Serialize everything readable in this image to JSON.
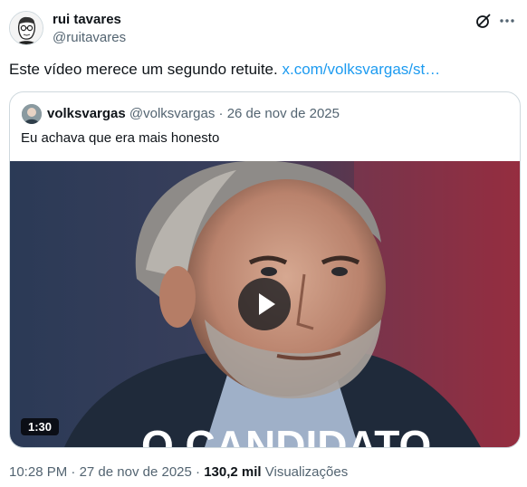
{
  "author": {
    "name": "rui tavares",
    "handle": "@ruitavares",
    "avatar_icon": "avatar-illustration-icon"
  },
  "actions": {
    "grok_icon": "grok-icon",
    "more_icon": "more-icon"
  },
  "tweet": {
    "text": "Este vídeo merece um segundo retuite.",
    "link": "x.com/volksvargas/st…"
  },
  "quoted": {
    "name": "volksvargas",
    "handle": "@volksvargas",
    "separator": "·",
    "date": "26 de nov de 2025",
    "text": "Eu achava que era mais honesto",
    "video": {
      "duration": "1:30",
      "overlay_text": "O CANDIDATO",
      "play_icon": "play-icon"
    }
  },
  "footer": {
    "time": "10:28 PM",
    "separator": "·",
    "date": "27 de nov de 2025",
    "views_count": "130,2 mil",
    "views_label": "Visualizações"
  },
  "colors": {
    "link": "#1d9bf0",
    "secondary_text": "#536471",
    "primary_text": "#0f1419",
    "border": "#cfd9de"
  }
}
